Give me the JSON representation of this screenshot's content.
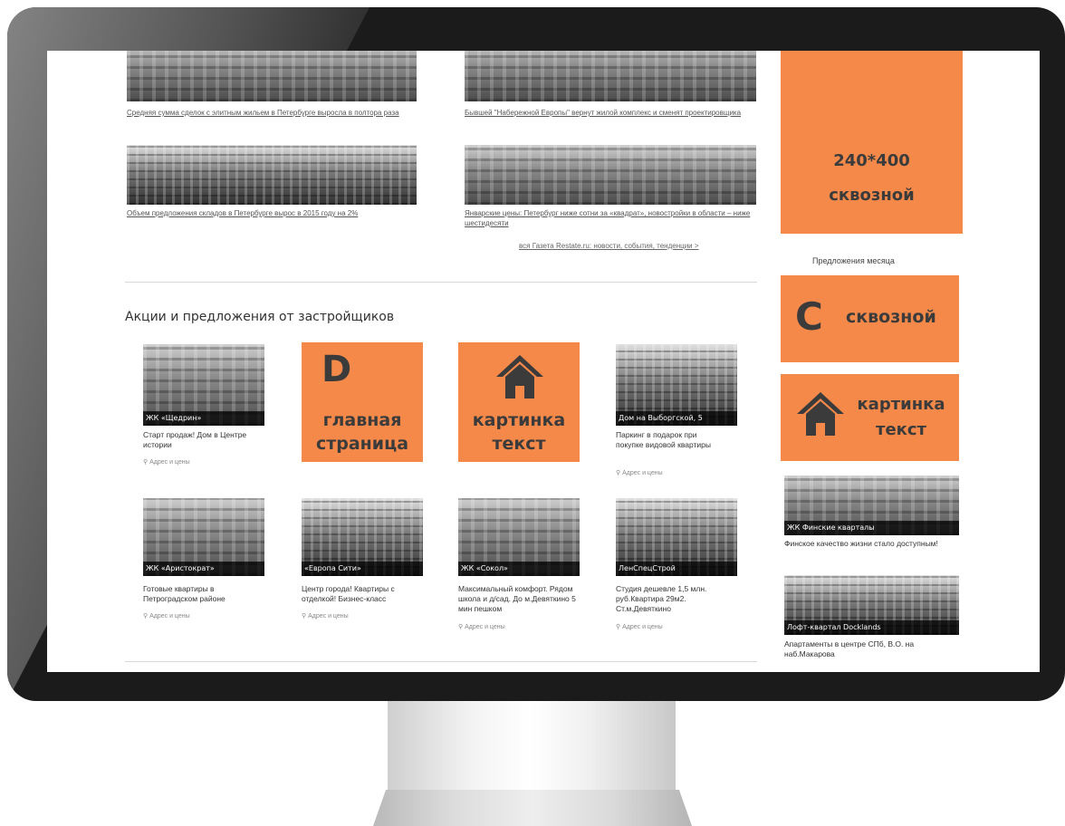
{
  "news": [
    {
      "text": "Средняя сумма сделок с элитным жильем в Петербурге выросла в полтора раза"
    },
    {
      "text": "Бывшей \"Набережной Европы\" вернут жилой комплекс и сменят проектировщика"
    },
    {
      "text": "Объем предложения складов в Петербурге вырос в 2015 году на 2%"
    },
    {
      "text": "Январские цены: Петербург ниже сотни за «квадрат», новостройки в области – ниже шестидесяти"
    }
  ],
  "all_news_link": "вся Газета Restate.ru: новости, события, тенденции >",
  "section_title": "Акции и предложения от застройщиков",
  "cards_row1": [
    {
      "caption": "ЖК «Щедрин»",
      "text": "Старт продаж! Дом в Центре истории",
      "addr": "Адрес и цены"
    },
    {
      "caption": "Дом на Выборгской, 5",
      "text": "Паркинг в подарок при покупке видовой квартиры",
      "addr": "Адрес и цены"
    }
  ],
  "banner_d": {
    "letter": "D",
    "line1": "главная",
    "line2": "страница"
  },
  "banner_pic": {
    "line1": "картинка",
    "line2": "текст"
  },
  "cards_row2": [
    {
      "caption": "ЖК «Аристократ»",
      "text": "Готовые квартиры в Петроградском районе",
      "addr": "Адрес и цены"
    },
    {
      "caption": "«Европа Сити»",
      "text": "Центр города! Квартиры с отделкой! Бизнес-класс",
      "addr": "Адрес и цены"
    },
    {
      "caption": "ЖК «Сокол»",
      "text": "Максимальный комфорт. Рядом школа и д/сад. До м.Девяткино 5 мин пешком",
      "addr": "Адрес и цены"
    },
    {
      "caption": "ЛенСпецСтрой",
      "text": "Студия дешевле 1,5 млн. руб.Квартира 29м2. Ст.м.Девяткино",
      "addr": "Адрес и цены"
    }
  ],
  "sidebar": {
    "banner_240": {
      "line1": "240*400",
      "line2": "сквозной"
    },
    "offers_label": "Предложения месяца",
    "banner_c": {
      "letter": "C",
      "text": "сквозной"
    },
    "banner_pic": {
      "line1": "картинка",
      "line2": "текст"
    },
    "cards": [
      {
        "caption": "ЖК Финские кварталы",
        "text": "Финское качество жизни стало доступным!"
      },
      {
        "caption": "Лофт-квартал Docklands",
        "text": "Апартаменты в центре СПб, В.О. на наб.Макарова"
      }
    ]
  },
  "colors": {
    "accent": "#f4894a",
    "banner_text": "#3b3b3b"
  }
}
